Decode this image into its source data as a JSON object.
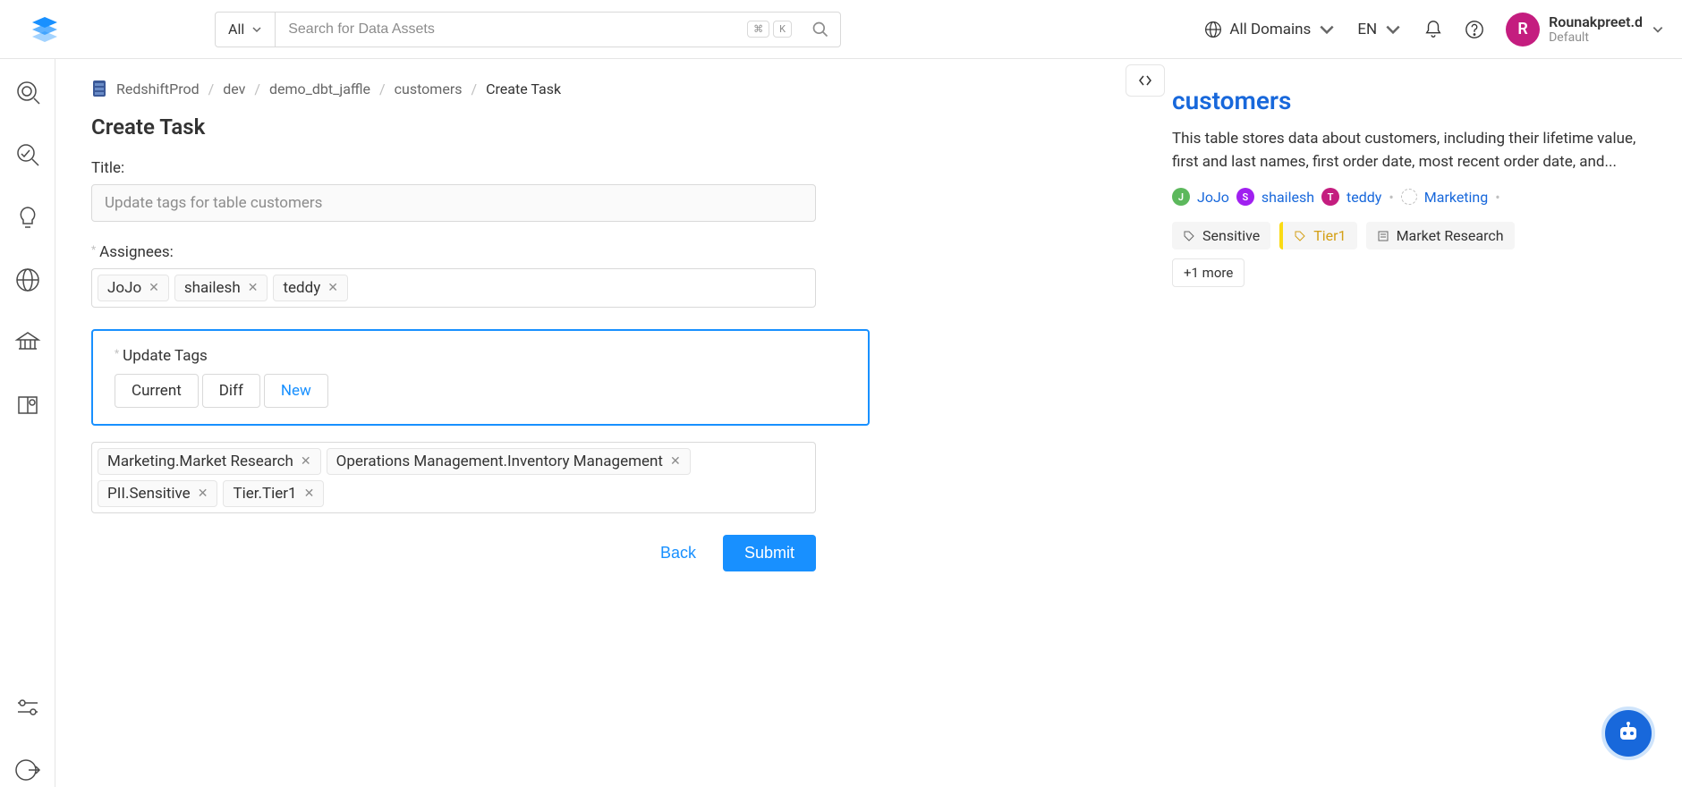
{
  "topbar": {
    "search_scope": "All",
    "search_placeholder": "Search for Data Assets",
    "cmd_key": "⌘",
    "k_key": "K",
    "domains": "All Domains",
    "lang": "EN",
    "user_initial": "R",
    "user_name": "Rounakpreet.d",
    "user_sub": "Default"
  },
  "breadcrumb": {
    "items": [
      "RedshiftProd",
      "dev",
      "demo_dbt_jaffle",
      "customers",
      "Create Task"
    ]
  },
  "page": {
    "title": "Create Task",
    "title_label": "Title:",
    "title_value": "Update tags for table customers",
    "assignees_label": "Assignees:",
    "assignees": [
      "JoJo",
      "shailesh",
      "teddy"
    ],
    "update_tags_label": "Update Tags",
    "tabs": {
      "current": "Current",
      "diff": "Diff",
      "new": "New"
    },
    "tags": [
      "Marketing.Market Research",
      "Operations Management.Inventory Management",
      "PII.Sensitive",
      "Tier.Tier1"
    ],
    "back": "Back",
    "submit": "Submit"
  },
  "panel": {
    "title": "customers",
    "desc": "This table stores data about customers, including their lifetime value, first and last names, first order date, most recent order date, and...",
    "owners": [
      "JoJo",
      "shailesh",
      "teddy"
    ],
    "dept": "Marketing",
    "tags": {
      "sensitive": "Sensitive",
      "tier": "Tier1",
      "market": "Market Research"
    },
    "more": "+1 more"
  }
}
